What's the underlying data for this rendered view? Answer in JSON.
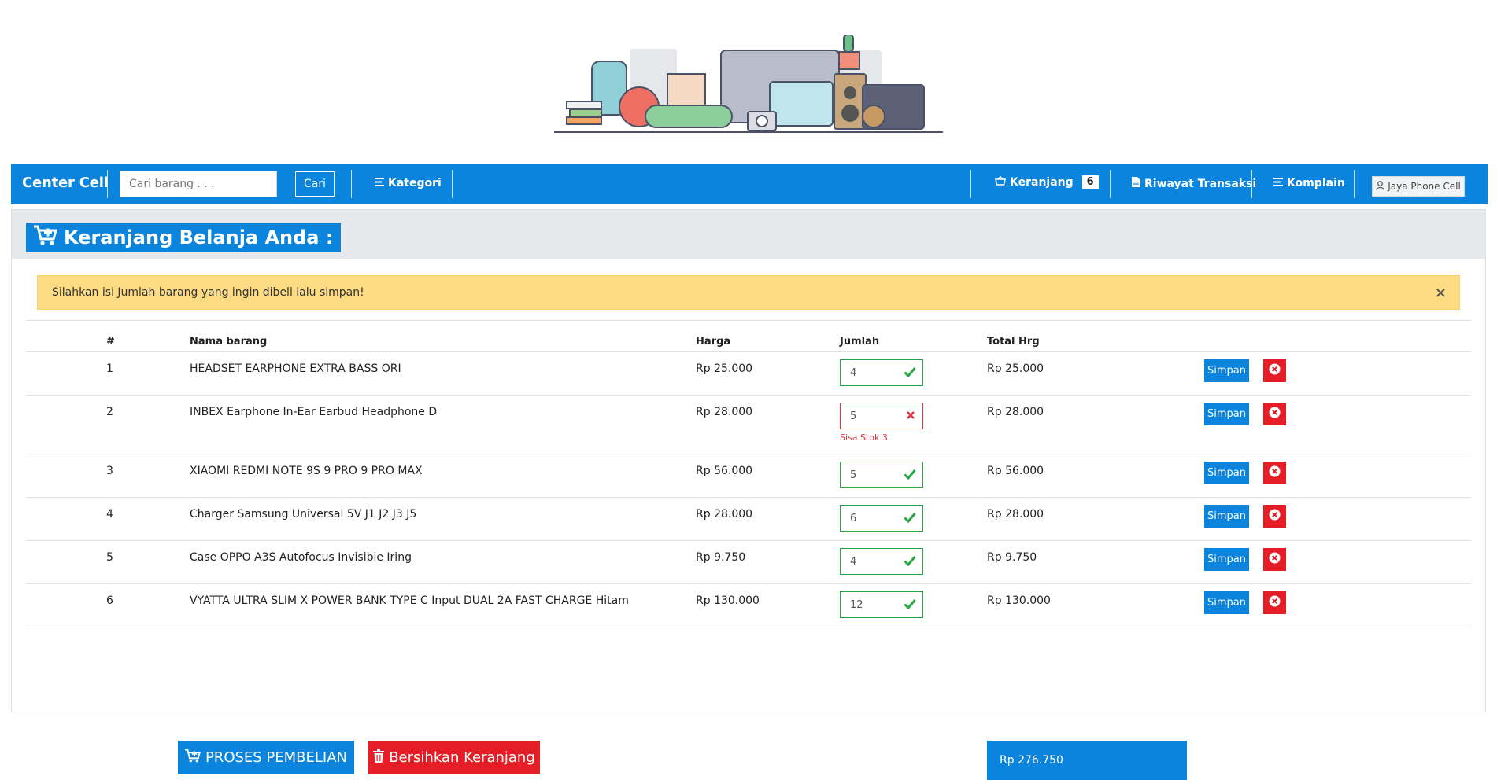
{
  "navbar": {
    "brand": "Center Cell",
    "search_placeholder": "Cari barang . . .",
    "search_button": "Cari",
    "kategori": "Kategori",
    "keranjang": "Keranjang",
    "keranjang_count": "6",
    "riwayat": "Riwayat Transaksi",
    "komplain": "Komplain",
    "user": "Jaya Phone Cell"
  },
  "page": {
    "title": "Keranjang Belanja Anda :",
    "alert": "Silahkan isi Jumlah barang yang ingin dibeli lalu simpan!",
    "alert_close": "×"
  },
  "table": {
    "headers": {
      "no": "#",
      "name": "Nama barang",
      "price": "Harga",
      "qty": "Jumlah",
      "total": "Total Hrg"
    },
    "rows": [
      {
        "no": "1",
        "name": "HEADSET EARPHONE EXTRA BASS ORI",
        "price": "Rp 25.000",
        "qty": "4",
        "valid": true,
        "error": "",
        "total": "Rp 25.000"
      },
      {
        "no": "2",
        "name": "INBEX Earphone In-Ear Earbud Headphone D",
        "price": "Rp 28.000",
        "qty": "5",
        "valid": false,
        "error": "Sisa Stok 3",
        "total": "Rp 28.000"
      },
      {
        "no": "3",
        "name": "XIAOMI REDMI NOTE 9S 9 PRO 9 PRO MAX",
        "price": "Rp 56.000",
        "qty": "5",
        "valid": true,
        "error": "",
        "total": "Rp 56.000"
      },
      {
        "no": "4",
        "name": "Charger Samsung Universal 5V J1 J2 J3 J5",
        "price": "Rp 28.000",
        "qty": "6",
        "valid": true,
        "error": "",
        "total": "Rp 28.000"
      },
      {
        "no": "5",
        "name": "Case OPPO A3S Autofocus Invisible Iring",
        "price": "Rp 9.750",
        "qty": "4",
        "valid": true,
        "error": "",
        "total": "Rp 9.750"
      },
      {
        "no": "6",
        "name": "VYATTA ULTRA SLIM X POWER BANK TYPE C Input DUAL 2A FAST CHARGE Hitam",
        "price": "Rp 130.000",
        "qty": "12",
        "valid": true,
        "error": "",
        "total": "Rp 130.000"
      }
    ],
    "save_label": "Simpan"
  },
  "actions": {
    "process": "PROSES PEMBELIAN",
    "clear": "Bersihkan Keranjang",
    "grand_total": "Rp 276.750"
  },
  "colors": {
    "primary": "#0a84dd",
    "danger": "#e51d27",
    "success": "#28a745",
    "warning": "#fddb82"
  }
}
